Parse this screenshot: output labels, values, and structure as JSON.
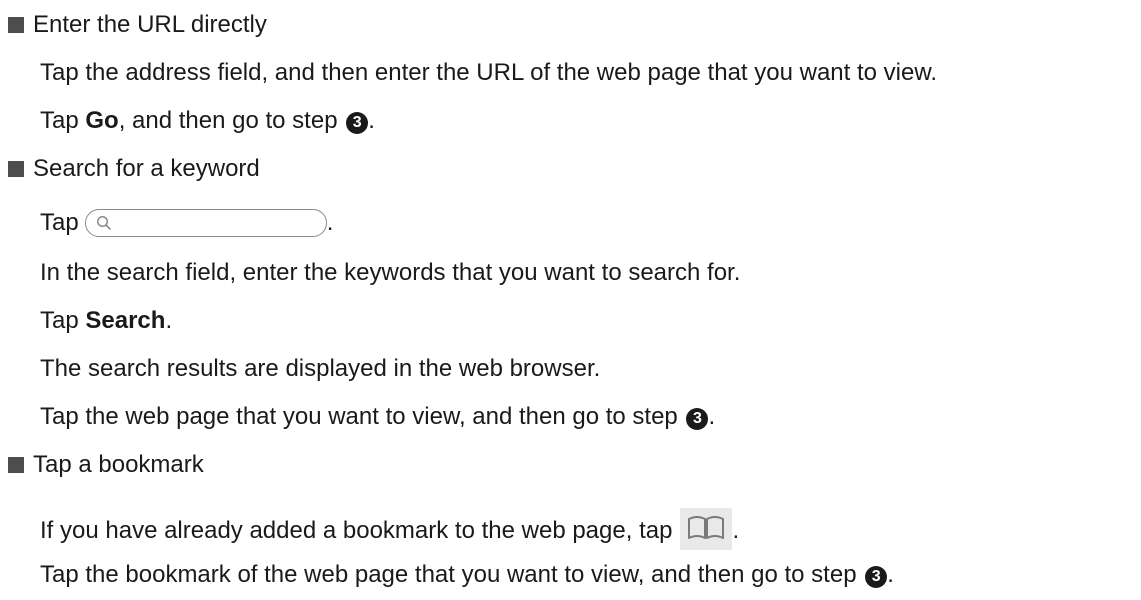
{
  "sections": [
    {
      "heading": "Enter the URL directly",
      "lines": {
        "l1": "Tap the address field, and then enter the URL of the web page that you want to view.",
        "l2_pre": "Tap ",
        "l2_bold": "Go",
        "l2_post": ", and then go to step ",
        "l2_end": "."
      }
    },
    {
      "heading": "Search for a keyword",
      "lines": {
        "l1_pre": "Tap",
        "l1_end": ".",
        "l2": "In the search field, enter the keywords that you want to search for.",
        "l3_pre": "Tap ",
        "l3_bold": "Search",
        "l3_end": ".",
        "l4": "The search results are displayed in the web browser.",
        "l5_pre": "Tap the web page that you want to view, and then go to step ",
        "l5_end": "."
      }
    },
    {
      "heading": "Tap a bookmark",
      "lines": {
        "l1_pre": "If you have already added a bookmark to the web page, tap",
        "l1_end": ".",
        "l2_pre": "Tap the bookmark of the web page that you want to view, and then go to step ",
        "l2_end": "."
      }
    }
  ],
  "step_marker": "3",
  "icons": {
    "bullet": "square-bullet-icon",
    "search_field": "search-field-icon",
    "bookmark": "bookmark-book-icon"
  },
  "colors": {
    "text": "#1a1a1a",
    "bullet": "#4d4d4d",
    "bookmark_bg": "#e9e9e9"
  }
}
